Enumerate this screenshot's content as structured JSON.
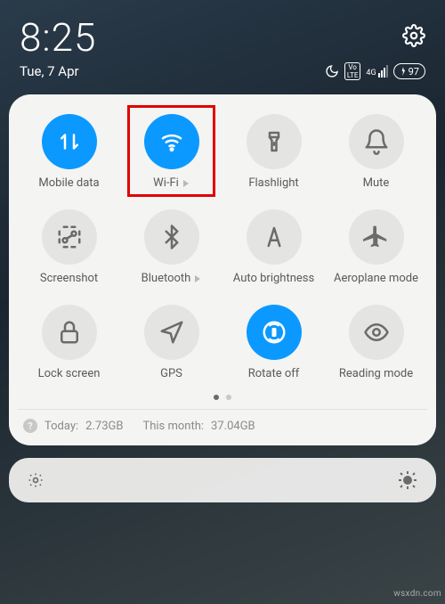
{
  "status": {
    "time": "8:25",
    "date": "Tue, 7 Apr",
    "battery": "97",
    "signal_label": "4G",
    "volte_label": "Vo LTE"
  },
  "tiles": [
    {
      "name": "mobile-data",
      "label": "Mobile data",
      "active": true,
      "expandable": false,
      "icon": "mobile-data-icon"
    },
    {
      "name": "wifi",
      "label": "Wi-Fi",
      "active": true,
      "expandable": true,
      "icon": "wifi-icon",
      "highlighted": true
    },
    {
      "name": "flashlight",
      "label": "Flashlight",
      "active": false,
      "expandable": false,
      "icon": "flashlight-icon"
    },
    {
      "name": "mute",
      "label": "Mute",
      "active": false,
      "expandable": false,
      "icon": "mute-icon"
    },
    {
      "name": "screenshot",
      "label": "Screenshot",
      "active": false,
      "expandable": false,
      "icon": "screenshot-icon"
    },
    {
      "name": "bluetooth",
      "label": "Bluetooth",
      "active": false,
      "expandable": true,
      "icon": "bluetooth-icon"
    },
    {
      "name": "auto-brightness",
      "label": "Auto brightness",
      "active": false,
      "expandable": false,
      "icon": "auto-brightness-icon"
    },
    {
      "name": "aeroplane-mode",
      "label": "Aeroplane mode",
      "active": false,
      "expandable": false,
      "icon": "aeroplane-mode-icon"
    },
    {
      "name": "lock-screen",
      "label": "Lock screen",
      "active": false,
      "expandable": false,
      "icon": "lock-screen-icon"
    },
    {
      "name": "gps",
      "label": "GPS",
      "active": false,
      "expandable": false,
      "icon": "gps-icon"
    },
    {
      "name": "rotate-off",
      "label": "Rotate off",
      "active": true,
      "expandable": false,
      "icon": "rotate-off-icon"
    },
    {
      "name": "reading-mode",
      "label": "Reading mode",
      "active": false,
      "expandable": false,
      "icon": "reading-mode-icon"
    }
  ],
  "usage": {
    "today_label": "Today:",
    "today_value": "2.73GB",
    "month_label": "This month:",
    "month_value": "37.04GB"
  },
  "watermark": "wsxdn.com"
}
